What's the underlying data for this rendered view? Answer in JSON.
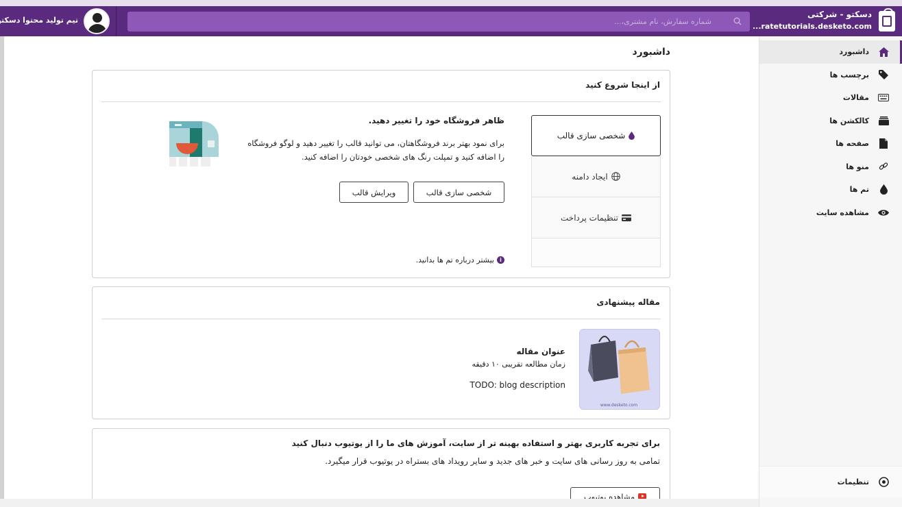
{
  "header": {
    "brand_name": "دسکتو - شرکتی",
    "brand_url": "...ratetutorials.desketo.com",
    "search_placeholder": "شماره سفارش، نام مشتری،...",
    "user_name": "تیم تولید محتوا دسکتو"
  },
  "sidebar": {
    "items": [
      {
        "label": "داشبورد",
        "icon": "home-icon",
        "active": true
      },
      {
        "label": "برچسب ها",
        "icon": "tag-icon",
        "active": false
      },
      {
        "label": "مقالات",
        "icon": "keyboard-icon",
        "active": false
      },
      {
        "label": "کالکشن ها",
        "icon": "collection-icon",
        "active": false
      },
      {
        "label": "صفحه ها",
        "icon": "page-icon",
        "active": false
      },
      {
        "label": "منو ها",
        "icon": "link-icon",
        "active": false
      },
      {
        "label": "تم ها",
        "icon": "drop-icon",
        "active": false
      },
      {
        "label": "مشاهده سایت",
        "icon": "eye-icon",
        "active": false
      }
    ],
    "settings_label": "تنظیمات"
  },
  "main": {
    "page_title": "داشبورد",
    "start_card": {
      "title": "از اینجا شروع کنید",
      "tabs": [
        {
          "label": "شخصی سازی قالب",
          "icon": "drop-icon",
          "active": true
        },
        {
          "label": "ایجاد دامنه",
          "icon": "globe-icon",
          "active": false
        },
        {
          "label": "تنظیمات پرداخت",
          "icon": "card-icon",
          "active": false
        }
      ],
      "feature_title": "ظاهر فروشگاه خود را تغییر دهید.",
      "feature_desc": "برای نمود بهتر برند فروشگاهتان، می توانید قالب را تغییر دهید و لوگو فروشگاه را اضافه کنید و تمپلت رنگ های شخصی خودتان را اضافه کنید.",
      "btn_customize": "شخصی سازی قالب",
      "btn_edit": "ویرایش قالب",
      "learn_more": "بیشتر درباره تم ها بدانید."
    },
    "article_card": {
      "title": "مقاله پیشنهادی",
      "article_title": "عنوان مقاله",
      "article_meta": "زمان مطالعه تقریبی ۱۰ دقیقه",
      "article_desc": "TODO: blog description",
      "image_watermark": "www.desketo.com"
    },
    "youtube_card": {
      "title": "برای تجربه کاربری بهتر و استفاده بهینه تر از سایت، آموزش های ما را از یوتیوب دنبال کنید",
      "desc": "تمامی به روز رسانی های سایت و خبر های جدید و سایر رویداد های بستراه در یوتیوب قرار میگیرد.",
      "button": "مشاهده یوتیوب"
    }
  },
  "colors": {
    "brand": "#5a2a7e",
    "search_bg": "#8e58b9"
  }
}
